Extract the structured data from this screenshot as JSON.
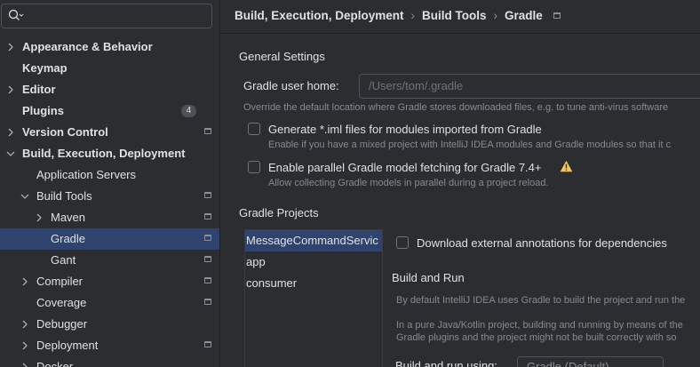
{
  "search": {
    "placeholder": ""
  },
  "sidebar": {
    "items": [
      {
        "label": "Appearance & Behavior"
      },
      {
        "label": "Keymap"
      },
      {
        "label": "Editor"
      },
      {
        "label": "Plugins",
        "badge": "4"
      },
      {
        "label": "Version Control"
      },
      {
        "label": "Build, Execution, Deployment"
      },
      {
        "label": "Application Servers"
      },
      {
        "label": "Build Tools"
      },
      {
        "label": "Maven"
      },
      {
        "label": "Gradle"
      },
      {
        "label": "Gant"
      },
      {
        "label": "Compiler"
      },
      {
        "label": "Coverage"
      },
      {
        "label": "Debugger"
      },
      {
        "label": "Deployment"
      },
      {
        "label": "Docker"
      }
    ]
  },
  "breadcrumb": {
    "items": [
      "Build, Execution, Deployment",
      "Build Tools",
      "Gradle"
    ],
    "separator": "›"
  },
  "general": {
    "title": "General Settings",
    "user_home_label": "Gradle user home:",
    "user_home_value": "/Users/tom/.gradle",
    "user_home_hint": "Override the default location where Gradle stores downloaded files, e.g. to tune anti-virus software",
    "iml_label": "Generate *.iml files for modules imported from Gradle",
    "iml_hint": "Enable if you have a mixed project with IntelliJ IDEA modules and Gradle modules so that it c",
    "parallel_label": "Enable parallel Gradle model fetching for Gradle 7.4+",
    "parallel_hint": "Allow collecting Gradle models in parallel during a project reload."
  },
  "projects": {
    "title": "Gradle Projects",
    "items": [
      "MessageCommandServic",
      "app",
      "consumer"
    ],
    "download_annotations_label": "Download external annotations for dependencies",
    "build_run_title": "Build and Run",
    "build_run_text1": "By default IntelliJ IDEA uses Gradle to build the project and run the",
    "build_run_text2": "In a pure Java/Kotlin project, building and running by means of the",
    "build_run_text3": "Gradle plugins and the project might not be built correctly with so",
    "build_run_using_label": "Build and run using:",
    "build_run_using_value": "Gradle (Default)"
  },
  "colors": {
    "selection": "#2e436e",
    "background": "#2b2d30",
    "warning": "#f2c55c"
  }
}
